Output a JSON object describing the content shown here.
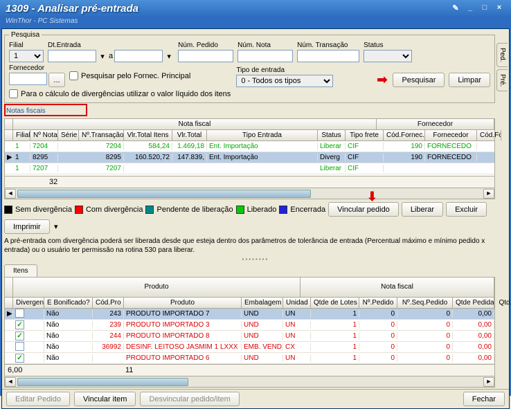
{
  "window": {
    "title": "1309 - Analisar pré-entrada",
    "subtitle": "WinThor - PC Sistemas"
  },
  "titlebar_icons": {
    "edit": "✎",
    "min": "_",
    "max": "□",
    "close": "×"
  },
  "side_tabs": [
    "Ped.",
    "Pré."
  ],
  "search": {
    "legend": "Pesquisa",
    "filial_label": "Filial",
    "filial_value": "1",
    "dtentrada_label": "Dt.Entrada",
    "a": "a",
    "numpedido_label": "Núm. Pedido",
    "numnota_label": "Núm. Nota",
    "numtrans_label": "Núm. Transação",
    "status_label": "Status",
    "fornecedor_label": "Fornecedor",
    "fornec_btn": "...",
    "pesq_princ_label": "Pesquisar pelo Fornec. Principal",
    "tipoentrada_label": "Tipo de entrada",
    "tipoentrada_value": "0 - Todos os tipos",
    "calc_div_label": "Para o cálculo de divergências utilizar o valor líquido dos itens",
    "pesquisar_btn": "Pesquisar",
    "limpar_btn": "Limpar"
  },
  "nf_label": "Notas fiscais",
  "nf_grid": {
    "group1": "Nota fiscal",
    "group2": "Fornecedor",
    "headers": [
      "Filial",
      "Nº Nota",
      "Série",
      "Nº.Transação",
      "Vlr.Total Itens",
      "Vlr.Total",
      "Tipo Entrada",
      "Status",
      "Tipo frete",
      "Cód.Fornec.",
      "Fornecedor",
      "Cód.Fo"
    ],
    "rows": [
      {
        "cls": "green",
        "c": [
          "1",
          "7204",
          "",
          "7204",
          "584,24",
          "1.469,18",
          "Ent. Importação",
          "Liberar",
          "CIF",
          "190",
          "FORNECEDO",
          ""
        ]
      },
      {
        "cls": "sel",
        "c": [
          "1",
          "8295",
          "",
          "8295",
          "160.520,72",
          "147.839,",
          "Ent. Importação",
          "Diverg",
          "CIF",
          "190",
          "FORNECEDO",
          ""
        ]
      },
      {
        "cls": "green",
        "c": [
          "1",
          "7207",
          "",
          "7207",
          "",
          "",
          "",
          "Liberar",
          "CIF",
          "",
          "",
          ""
        ]
      }
    ],
    "total_count": "32"
  },
  "legend": {
    "items": [
      {
        "color": "#000",
        "label": "Sem divergência"
      },
      {
        "color": "#f00",
        "label": "Com divergência"
      },
      {
        "color": "#088",
        "label": "Pendente de liberação"
      },
      {
        "color": "#0c0",
        "label": "Liberado"
      },
      {
        "color": "#22d",
        "label": "Encerrada"
      }
    ],
    "vincular_btn": "Vincular pedido",
    "liberar_btn": "Liberar",
    "excluir_btn": "Excluir",
    "imprimir_btn": "Imprimir"
  },
  "info": "A pré-entrada com divergência poderá ser liberada desde que esteja dentro dos parâmetros de tolerância de entrada (Percentual máximo e mínimo pedido x entrada) ou o usuário ter permissão na rotina 530 para liberar.",
  "itens_tab": "Itens",
  "itens_grid": {
    "group1": "Produto",
    "group2": "Nota fiscal",
    "headers": [
      "Divergent",
      "E Bonificado?",
      "Cód.Pro",
      "Produto",
      "Embalagem",
      "Unidad",
      "Qtde de Lotes",
      "Nº.Pedido",
      "Nº.Seq.Pedido",
      "Qtde Pedida",
      "Qtd"
    ],
    "rows": [
      {
        "chk": "",
        "bon": "Não",
        "cls": "sel",
        "c": [
          "243",
          "PRODUTO IMPORTADO 7",
          "UND",
          "UN",
          "1",
          "0",
          "0",
          "0,00",
          ""
        ]
      },
      {
        "chk": "✓",
        "bon": "Não",
        "cls": "red",
        "c": [
          "239",
          "PRODUTO IMPORTADO 3",
          "UND",
          "UN",
          "1",
          "0",
          "0",
          "0,00",
          ""
        ]
      },
      {
        "chk": "✓",
        "bon": "Não",
        "cls": "red",
        "c": [
          "244",
          "PRODUTO IMPORTADO 8",
          "UND",
          "UN",
          "1",
          "0",
          "0",
          "0,00",
          ""
        ]
      },
      {
        "chk": "",
        "bon": "Não",
        "cls": "red",
        "c": [
          "36992",
          "DESINF. LEITOSO JASMIM 1 LXXX",
          "EMB. VEND",
          "CX",
          "1",
          "0",
          "0",
          "0,00",
          ""
        ]
      },
      {
        "chk": "✓",
        "bon": "Não",
        "cls": "red",
        "c": [
          "",
          "PRODUTO IMPORTADO 6",
          "UND",
          "UN",
          "1",
          "0",
          "0",
          "0,00",
          ""
        ]
      }
    ],
    "sum_left": "6,00",
    "sum_mid": "11"
  },
  "footer": {
    "editar_btn": "Editar Pedido",
    "vincular_item_btn": "Vincular item",
    "desvincular_btn": "Desvincular pedido/item",
    "fechar_btn": "Fechar"
  }
}
